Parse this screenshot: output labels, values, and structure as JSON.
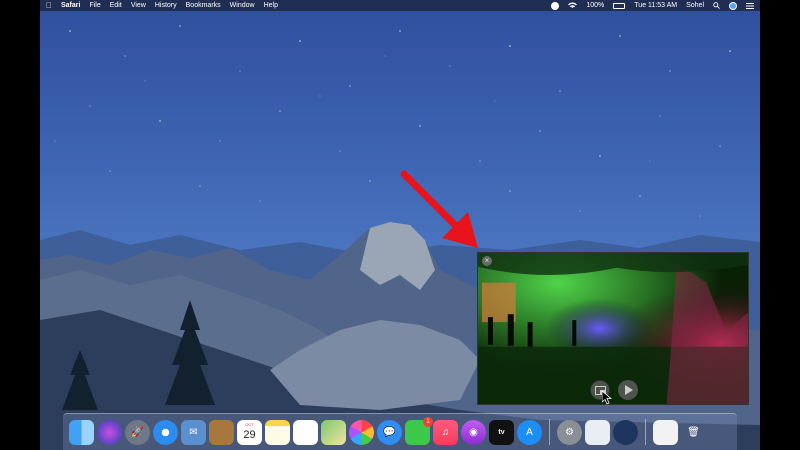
{
  "menubar": {
    "app_name": "Safari",
    "menus": [
      "File",
      "Edit",
      "View",
      "History",
      "Bookmarks",
      "Window",
      "Help"
    ],
    "battery": "100%",
    "clock": "Tue 11:53 AM",
    "user": "Sohel"
  },
  "pip": {
    "close_label": "×"
  },
  "dock": {
    "calendar_day": "29",
    "calendar_month": "OCT",
    "facetime_badge": "1",
    "tv_label": "tv"
  },
  "colors": {
    "arrow": "#e8141c",
    "sky_top": "#2f4f9c",
    "sky_bottom": "#5b86c8"
  }
}
